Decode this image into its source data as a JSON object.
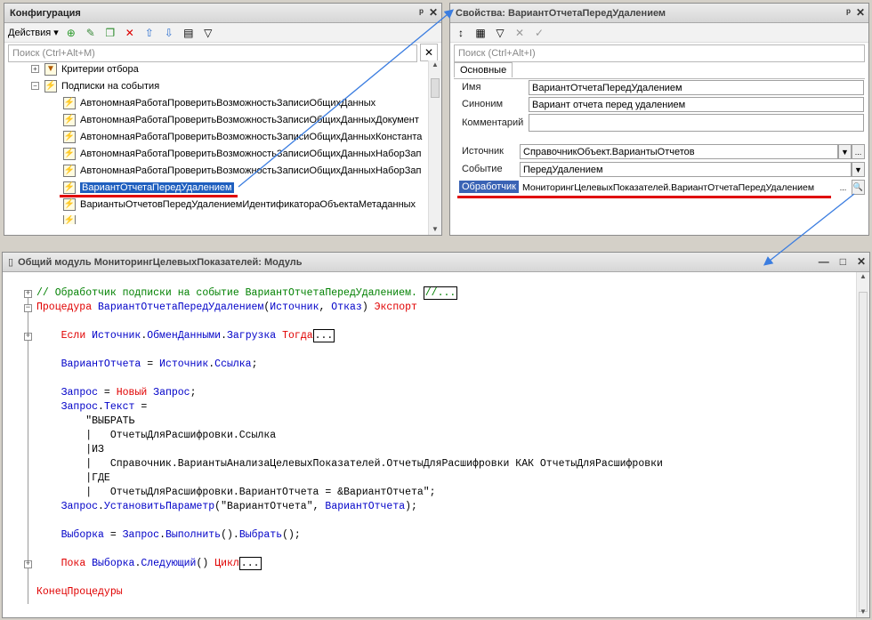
{
  "config": {
    "title": "Конфигурация",
    "actions": "Действия",
    "search_placeholder": "Поиск (Ctrl+Alt+M)",
    "tree": [
      "Критерии отбора",
      "Подписки на события",
      "АвтономнаяРаботаПроверитьВозможностьЗаписиОбщихДанных",
      "АвтономнаяРаботаПроверитьВозможностьЗаписиОбщихДанныхДокумент",
      "АвтономнаяРаботаПроверитьВозможностьЗаписиОбщихДанныхКонстанта",
      "АвтономнаяРаботаПроверитьВозможностьЗаписиОбщихДанныхНаборЗап",
      "АвтономнаяРаботаПроверитьВозможностьЗаписиОбщихДанныхНаборЗап",
      "ВариантОтчетаПередУдалением",
      "ВариантыОтчетовПередУдалениемИдентификатораОбъектаМетаданных"
    ]
  },
  "props": {
    "title": "Свойства: ВариантОтчетаПередУдалением",
    "search_placeholder": "Поиск (Ctrl+Alt+I)",
    "tab": "Основные",
    "labels": {
      "name": "Имя",
      "synonym": "Синоним",
      "comment": "Комментарий",
      "source": "Источник",
      "event": "Событие",
      "handler": "Обработчик"
    },
    "values": {
      "name": "ВариантОтчетаПередУдалением",
      "synonym": "Вариант отчета перед удалением",
      "comment": "",
      "source": "СправочникОбъект.ВариантыОтчетов",
      "event": "ПередУдалением",
      "handler": "МониторингЦелевыхПоказателей.ВариантОтчетаПередУдалением"
    },
    "ellipsis": "..."
  },
  "module": {
    "title": "Общий модуль МониторингЦелевыхПоказателей: Модуль"
  }
}
